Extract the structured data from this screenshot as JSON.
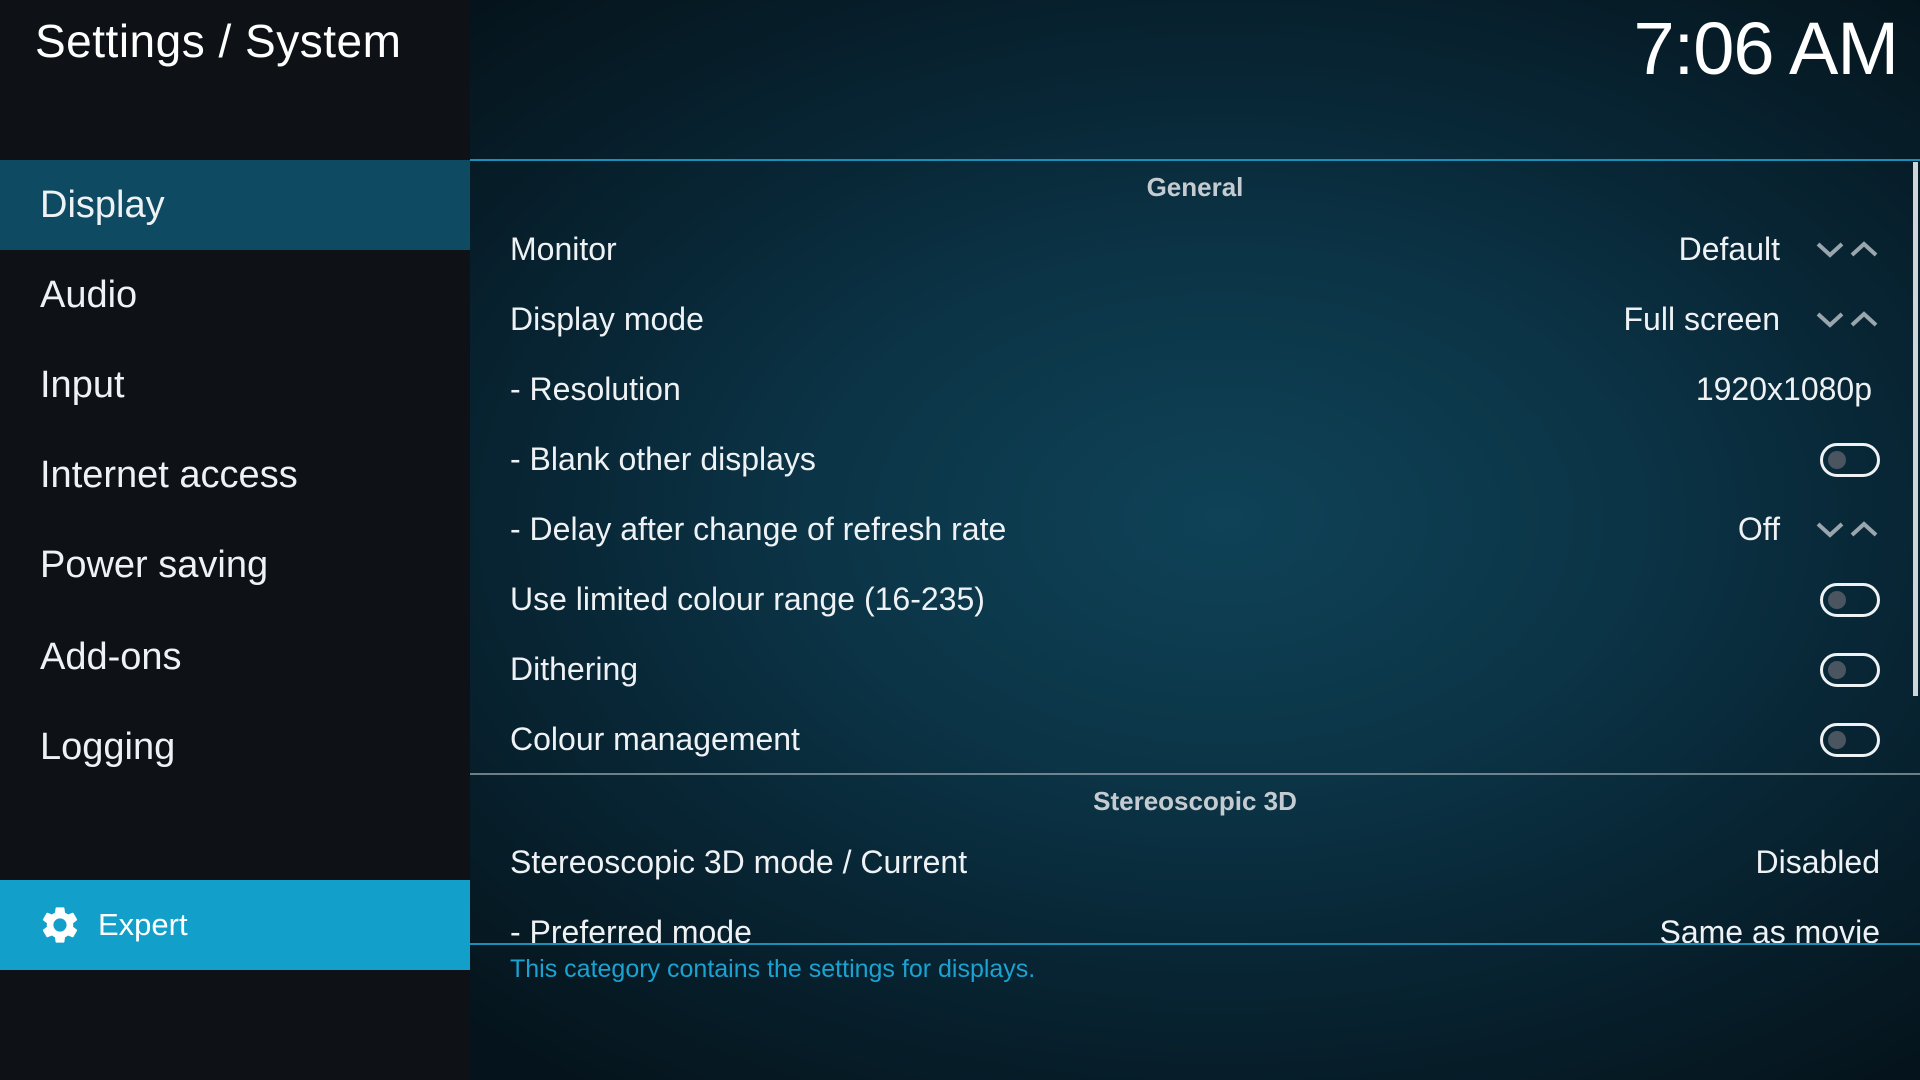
{
  "header": {
    "title": "Settings / System",
    "clock": "7:06 AM"
  },
  "sidebar": {
    "items": [
      {
        "label": "Display"
      },
      {
        "label": "Audio"
      },
      {
        "label": "Input"
      },
      {
        "label": "Internet access"
      },
      {
        "label": "Power saving"
      },
      {
        "label": "Add-ons"
      },
      {
        "label": "Logging"
      }
    ],
    "selected": "Display",
    "level_button": {
      "label": "Expert",
      "icon": "gear-icon"
    }
  },
  "sections": [
    {
      "title": "General",
      "settings": [
        {
          "label": "Monitor",
          "value": "Default",
          "control": "spinner"
        },
        {
          "label": "Display mode",
          "value": "Full screen",
          "control": "spinner"
        },
        {
          "label": "- Resolution",
          "value": "1920x1080p",
          "control": "value"
        },
        {
          "label": "- Blank other displays",
          "control": "toggle",
          "enabled": false
        },
        {
          "label": "- Delay after change of refresh rate",
          "value": "Off",
          "control": "spinner"
        },
        {
          "label": "Use limited colour range (16-235)",
          "control": "toggle",
          "enabled": false
        },
        {
          "label": "Dithering",
          "control": "toggle",
          "enabled": false
        },
        {
          "label": "Colour management",
          "control": "toggle",
          "enabled": false
        }
      ]
    },
    {
      "title": "Stereoscopic 3D",
      "settings": [
        {
          "label": "Stereoscopic 3D mode / Current",
          "value": "Disabled",
          "control": "value"
        },
        {
          "label": "- Preferred mode",
          "value": "Same as movie",
          "control": "value"
        }
      ]
    }
  ],
  "description": "This category contains the settings for displays.",
  "colors": {
    "accent": "#12a0cb",
    "selected_nav": "#0f4a63",
    "divider": "#1a8fb8",
    "hint_text": "#1aa3d2"
  }
}
